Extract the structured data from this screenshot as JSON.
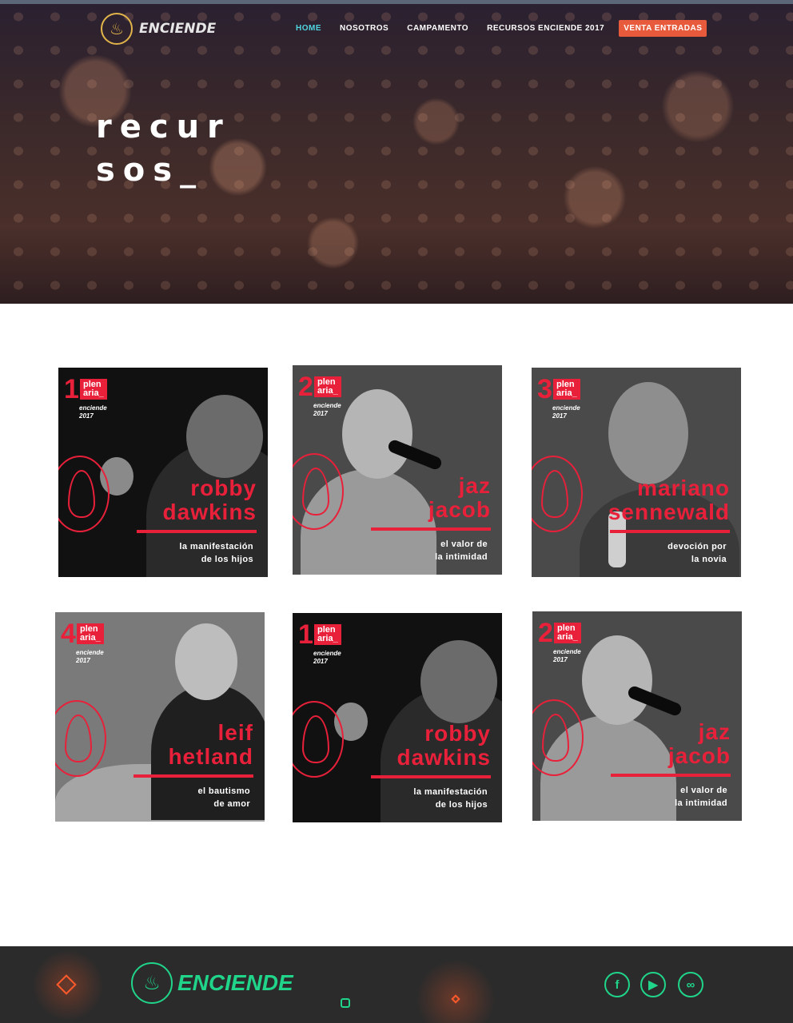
{
  "nav": {
    "logo_text": "ENCIENDE",
    "logo_icon": "flame-icon",
    "items": [
      {
        "label": "HOME",
        "active": true
      },
      {
        "label": "NOSOTROS",
        "active": false
      },
      {
        "label": "CAMPAMENTO",
        "active": false
      },
      {
        "label": "RECURSOS ENCIENDE 2017",
        "active": false
      }
    ],
    "cta_label": "VENTA ENTRADAS"
  },
  "hero": {
    "title_line1": "recur",
    "title_line2": "sos_"
  },
  "cards": [
    {
      "number": "1",
      "badge_top": "plen",
      "badge_bottom": "aria_",
      "event": "enciende",
      "year": "2017",
      "speaker_line1": "robby",
      "speaker_line2": "dawkins",
      "talk_line1": "la manifestación",
      "talk_line2": "de los hijos"
    },
    {
      "number": "2",
      "badge_top": "plen",
      "badge_bottom": "aria_",
      "event": "enciende",
      "year": "2017",
      "speaker_line1": "jaz",
      "speaker_line2": "jacob",
      "talk_line1": "el valor de",
      "talk_line2": "la intimidad"
    },
    {
      "number": "3",
      "badge_top": "plen",
      "badge_bottom": "aria_",
      "event": "enciende",
      "year": "2017",
      "speaker_line1": "mariano",
      "speaker_line2": "sennewald",
      "talk_line1": "devoción por",
      "talk_line2": "la novia"
    },
    {
      "number": "4",
      "badge_top": "plen",
      "badge_bottom": "aria_",
      "event": "enciende",
      "year": "2017",
      "speaker_line1": "leif",
      "speaker_line2": "hetland",
      "talk_line1": "el bautismo",
      "talk_line2": "de amor"
    },
    {
      "number": "1",
      "badge_top": "plen",
      "badge_bottom": "aria_",
      "event": "enciende",
      "year": "2017",
      "speaker_line1": "robby",
      "speaker_line2": "dawkins",
      "talk_line1": "la manifestación",
      "talk_line2": "de los hijos"
    },
    {
      "number": "2",
      "badge_top": "plen",
      "badge_bottom": "aria_",
      "event": "enciende",
      "year": "2017",
      "speaker_line1": "jaz",
      "speaker_line2": "jacob",
      "talk_line1": "el valor de",
      "talk_line2": "la intimidad"
    }
  ],
  "footer": {
    "logo_text": "ENCIENDE",
    "social": [
      "facebook-icon",
      "youtube-icon",
      "link-icon"
    ]
  },
  "colors": {
    "accent_red": "#e8203a",
    "nav_active": "#4fd6e0",
    "cta": "#e85a3c",
    "footer_green": "#20d48a",
    "footer_bg": "#2b2b2b"
  }
}
